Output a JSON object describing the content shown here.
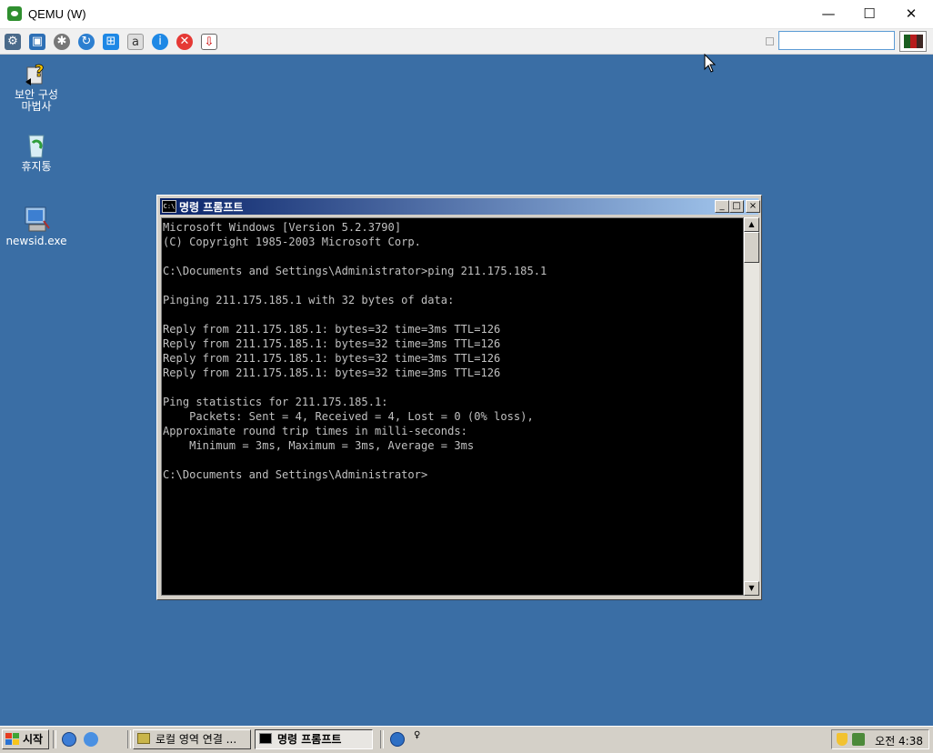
{
  "host": {
    "title": "QEMU (W)",
    "controls": {
      "minimize": "—",
      "maximize": "☐",
      "close": "✕"
    },
    "toolbar_icons": [
      "network-icon",
      "fullscreen-icon",
      "settings-icon",
      "refresh-icon",
      "windows-icon",
      "keyboard-icon",
      "info-icon",
      "stop-icon",
      "screenshot-icon"
    ],
    "search_value": ""
  },
  "desktop": {
    "icons": [
      {
        "label_line1": "보안 구성",
        "label_line2": "마법사",
        "icon": "security-wizard-icon"
      },
      {
        "label_line1": "휴지통",
        "label_line2": "",
        "icon": "recycle-bin-icon"
      },
      {
        "label_line1": "newsid.exe",
        "label_line2": "",
        "icon": "computer-icon"
      }
    ]
  },
  "cmd_window": {
    "title": "명령 프롬프트",
    "icon_text": "C:\\",
    "lines": [
      "Microsoft Windows [Version 5.2.3790]",
      "(C) Copyright 1985-2003 Microsoft Corp.",
      "",
      "C:\\Documents and Settings\\Administrator>ping 211.175.185.1",
      "",
      "Pinging 211.175.185.1 with 32 bytes of data:",
      "",
      "Reply from 211.175.185.1: bytes=32 time=3ms TTL=126",
      "Reply from 211.175.185.1: bytes=32 time=3ms TTL=126",
      "Reply from 211.175.185.1: bytes=32 time=3ms TTL=126",
      "Reply from 211.175.185.1: bytes=32 time=3ms TTL=126",
      "",
      "Ping statistics for 211.175.185.1:",
      "    Packets: Sent = 4, Received = 4, Lost = 0 (0% loss),",
      "Approximate round trip times in milli-seconds:",
      "    Minimum = 3ms, Maximum = 3ms, Average = 3ms",
      "",
      "C:\\Documents and Settings\\Administrator>"
    ],
    "controls": {
      "minimize": "_",
      "maximize": "□",
      "close": "×"
    }
  },
  "taskbar": {
    "start_label": "시작",
    "tasks": [
      {
        "label": "로컬 영역 연결 ...",
        "active": false
      },
      {
        "label": "명령 프롬프트",
        "active": true
      }
    ],
    "clock": "오전 4:38"
  }
}
